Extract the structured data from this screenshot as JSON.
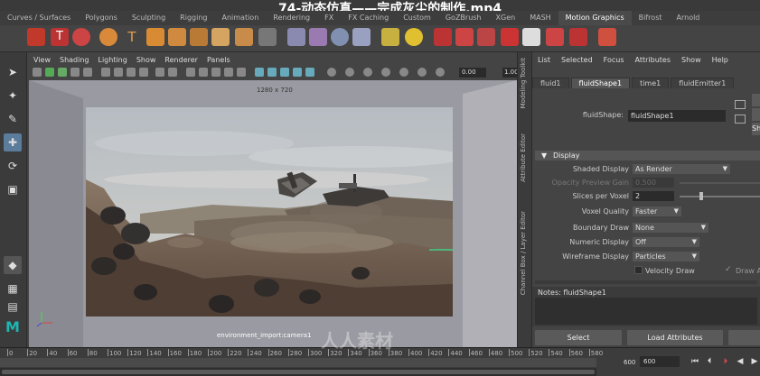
{
  "video_title": "74-动态仿真——完成灰尘的制作.mp4",
  "shelf_tabs": [
    "Curves / Surfaces",
    "Polygons",
    "Sculpting",
    "Rigging",
    "Animation",
    "Rendering",
    "FX",
    "FX Caching",
    "Custom",
    "GoZBrush",
    "XGen",
    "MASH",
    "Motion Graphics",
    "Bifrost",
    "Arnold"
  ],
  "shelf_active": "Motion Graphics",
  "viewport": {
    "menu": [
      "View",
      "Shading",
      "Lighting",
      "Show",
      "Renderer",
      "Panels"
    ],
    "num_field": "0.00",
    "num_field2": "1.00",
    "resolution": "1280 x 720",
    "camera_label": "environment_import:camera1"
  },
  "side_tabs": [
    "Modeling Toolkit",
    "Attribute Editor",
    "Channel Box / Layer Editor"
  ],
  "attr_editor": {
    "menu": [
      "List",
      "Selected",
      "Focus",
      "Attributes",
      "Show",
      "Help"
    ],
    "tabs": [
      "fluid1",
      "fluidShape1",
      "time1",
      "fluidEmitter1"
    ],
    "active_tab": "fluidShape1",
    "node_label": "fluidShape:",
    "node_value": "fluidShape1",
    "section": "Display",
    "rows": {
      "shaded_display": {
        "label": "Shaded Display",
        "value": "As Render"
      },
      "opacity_preview_gain": {
        "label": "Opacity Preview Gain",
        "value": "0.500"
      },
      "slices_per_voxel": {
        "label": "Slices per Voxel",
        "value": "2"
      },
      "voxel_quality": {
        "label": "Voxel Quality",
        "value": "Faster"
      },
      "boundary_draw": {
        "label": "Boundary Draw",
        "value": "None"
      },
      "numeric_display": {
        "label": "Numeric Display",
        "value": "Off"
      },
      "wireframe_display": {
        "label": "Wireframe Display",
        "value": "Particles"
      }
    },
    "velocity_draw": "Velocity Draw",
    "draw_arrows": "Draw Ar",
    "notes_title": "Notes: fluidShape1",
    "select_button": "Select",
    "load_attributes_button": "Load Attributes",
    "side_button": "Sh"
  },
  "timeline": {
    "ticks": [
      "0",
      "20",
      "40",
      "60",
      "80",
      "100",
      "120",
      "140",
      "160",
      "180",
      "200",
      "220",
      "240",
      "260",
      "280",
      "300",
      "320",
      "340",
      "360",
      "380",
      "400",
      "420",
      "440",
      "460",
      "480",
      "500",
      "520",
      "540",
      "560",
      "580"
    ],
    "end_frame": "600",
    "end_frame_field": "600"
  },
  "watermark": "人人素材"
}
